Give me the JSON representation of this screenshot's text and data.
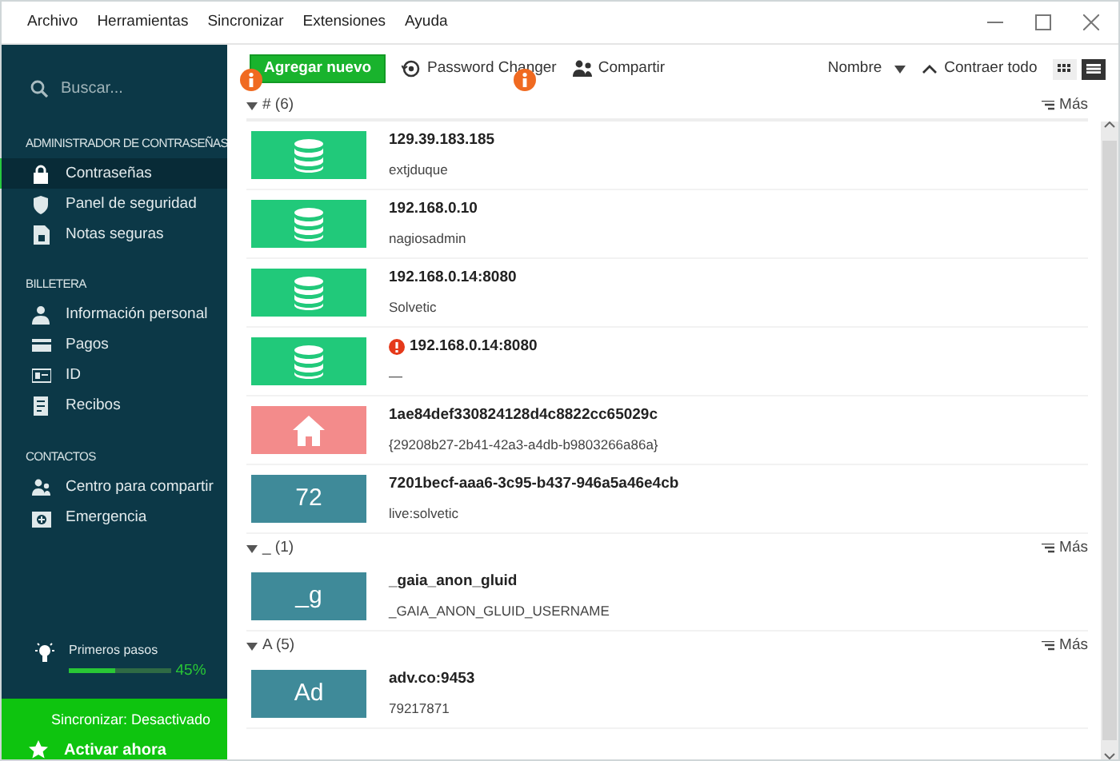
{
  "menu": [
    "Archivo",
    "Herramientas",
    "Sincronizar",
    "Extensiones",
    "Ayuda"
  ],
  "sidebar": {
    "search": {
      "placeholder": "Buscar..."
    },
    "sections": [
      {
        "title": "ADMINISTRADOR DE CONTRASEÑAS",
        "items": [
          {
            "label": "Contraseñas",
            "selected": true
          },
          {
            "label": "Panel de seguridad",
            "selected": false
          },
          {
            "label": "Notas seguras",
            "selected": false
          }
        ]
      },
      {
        "title": "BILLETERA",
        "items": [
          {
            "label": "Información personal",
            "selected": false
          },
          {
            "label": "Pagos",
            "selected": false
          },
          {
            "label": "ID",
            "selected": false
          },
          {
            "label": "Recibos",
            "selected": false
          }
        ]
      },
      {
        "title": "CONTACTOS",
        "items": [
          {
            "label": "Centro para compartir",
            "selected": false
          },
          {
            "label": "Emergencia",
            "selected": false
          }
        ]
      }
    ],
    "progress": {
      "label": "Primeros pasos",
      "level": 0.45,
      "reading": "45%"
    },
    "sync": {
      "status": "Sincronizar: Desactivado",
      "action": "Activar ahora"
    }
  },
  "toolbar": {
    "add_button": "Agregar nuevo",
    "tools": [
      "Password Changer",
      "Compartir"
    ],
    "sort": "Nombre",
    "collapse": "Contraer todo",
    "views": [
      {
        "selected": false
      },
      {
        "selected": true
      }
    ]
  },
  "groups": [
    {
      "title": "# (6)",
      "more": "Más",
      "items": [
        {
          "title": "129.39.183.185",
          "subtitle": "extjduque",
          "warning": false,
          "tile": {
            "kind": "database",
            "color": "#21c97a"
          }
        },
        {
          "title": "192.168.0.10",
          "subtitle": "nagiosadmin",
          "warning": false,
          "tile": {
            "kind": "database",
            "color": "#21c97a"
          }
        },
        {
          "title": "192.168.0.14:8080",
          "subtitle": "Solvetic",
          "warning": false,
          "tile": {
            "kind": "database",
            "color": "#21c97a"
          }
        },
        {
          "title": "192.168.0.14:8080",
          "subtitle": "—",
          "warning": true,
          "tile": {
            "kind": "database",
            "color": "#21c97a"
          }
        },
        {
          "title": "1ae84def330824128d4c8822cc65029c",
          "subtitle": "{29208b27-2b41-42a3-a4db-b9803266a86a}",
          "warning": false,
          "tile": {
            "kind": "home",
            "color": "#f38b8b"
          }
        },
        {
          "title": "7201becf-aaa6-3c95-b437-946a5a46e4cb",
          "subtitle": "live:solvetic",
          "warning": false,
          "tile": {
            "kind": "text",
            "label": "72",
            "color": "#3f8a99"
          }
        }
      ]
    },
    {
      "title": "_ (1)",
      "more": "Más",
      "items": [
        {
          "title": "_gaia_anon_gluid",
          "subtitle": "_GAIA_ANON_GLUID_USERNAME",
          "warning": false,
          "tile": {
            "kind": "text",
            "label": "_g",
            "color": "#3f8a99"
          }
        }
      ]
    },
    {
      "title": "A (5)",
      "more": "Más",
      "items": [
        {
          "title": "adv.co:9453",
          "subtitle": "79217871",
          "warning": false,
          "tile": {
            "kind": "text",
            "label": "Ad",
            "color": "#3f8a99"
          }
        }
      ]
    }
  ]
}
